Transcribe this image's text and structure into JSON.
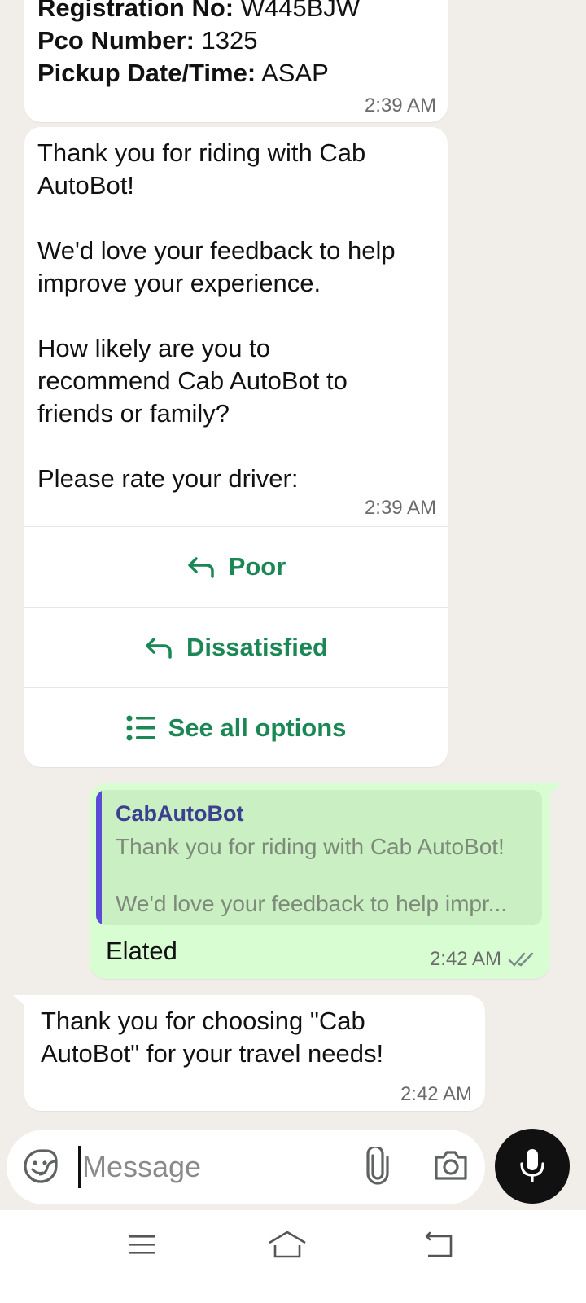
{
  "details_message": {
    "registration_label": "Registration No:",
    "registration_value": "W445BJW",
    "pco_label": "Pco Number:",
    "pco_value": "1325",
    "pickup_label": "Pickup Date/Time:",
    "pickup_value": "ASAP",
    "time": "2:39 AM"
  },
  "feedback_message": {
    "text": "Thank you for riding with Cab\nAutoBot!\n\nWe'd love your feedback to help\nimprove your experience.\n\nHow likely are you to\nrecommend Cab AutoBot to\nfriends or family?\n\nPlease rate your driver:",
    "time": "2:39 AM",
    "buttons": [
      "Poor",
      "Dissatisfied",
      "See all options"
    ]
  },
  "reply_message": {
    "quote_author": "CabAutoBot",
    "quote_line1": "Thank you for riding with Cab AutoBot!",
    "quote_line2": "We'd love your feedback to help impr...",
    "text": "Elated",
    "time": "2:42 AM"
  },
  "final_message": {
    "text": "Thank you for choosing \"Cab\nAutoBot\" for your travel needs!",
    "time": "2:42 AM"
  },
  "composer": {
    "placeholder": "Message"
  },
  "colors": {
    "background": "#f1eee9",
    "outgoing_bubble": "#d9fdd3",
    "action_green": "#1b8755",
    "quote_bar": "#5b4bd6"
  },
  "icons": [
    "reply-icon",
    "list-icon",
    "emoji-icon",
    "attach-icon",
    "camera-icon",
    "mic-icon",
    "read-receipt-icon",
    "menu-icon",
    "home-icon",
    "back-icon"
  ]
}
